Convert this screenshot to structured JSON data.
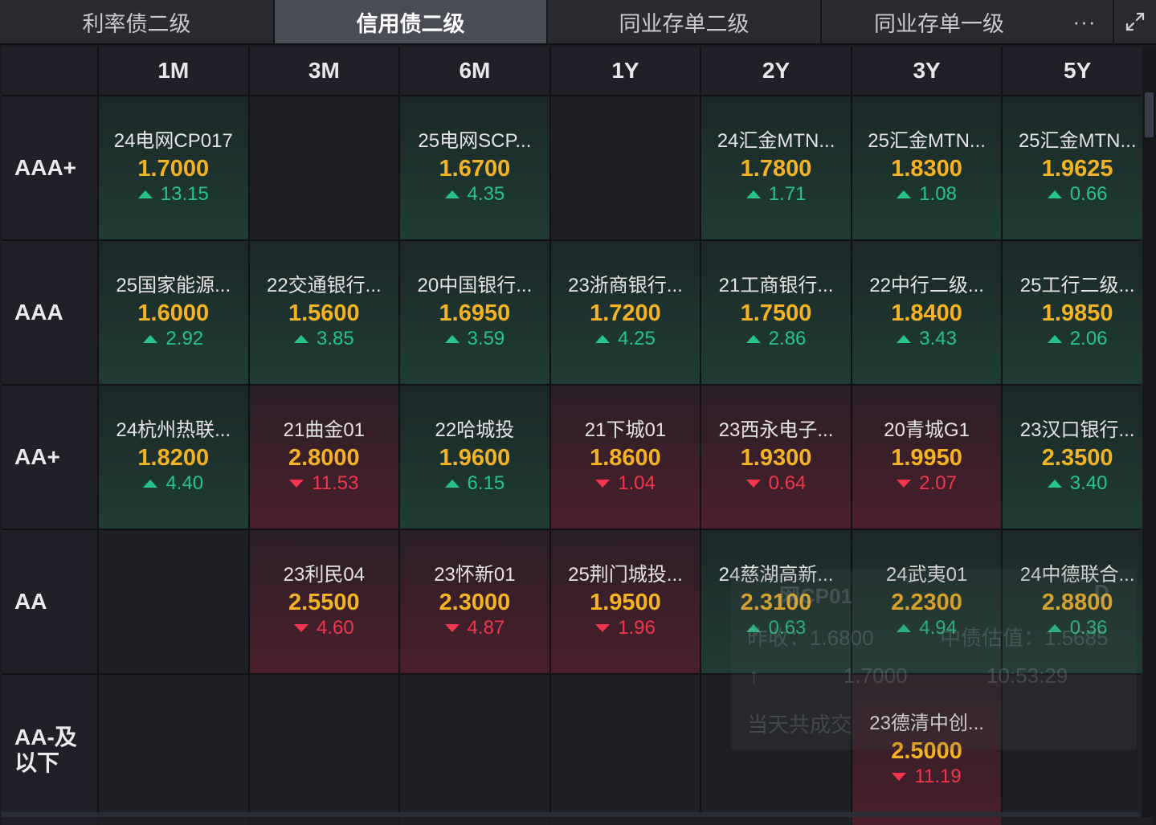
{
  "tabs": [
    {
      "label": "利率债二级",
      "active": false
    },
    {
      "label": "信用债二级",
      "active": true
    },
    {
      "label": "同业存单二级",
      "active": false
    },
    {
      "label": "同业存单一级",
      "active": false
    }
  ],
  "more_label": "···",
  "icons": {
    "more": "more-icon",
    "expand": "expand-icon"
  },
  "colors": {
    "rate": "#f5b324",
    "up": "#27c48a",
    "down": "#f2364b"
  },
  "columns": [
    "1M",
    "3M",
    "6M",
    "1Y",
    "2Y",
    "3Y",
    "5Y"
  ],
  "rows": [
    {
      "rating": "AAA+",
      "cells": [
        {
          "name": "24电网CP017",
          "rate": "1.7000",
          "change": "13.15",
          "dir": "up"
        },
        null,
        {
          "name": "25电网SCP...",
          "rate": "1.6700",
          "change": "4.35",
          "dir": "up"
        },
        null,
        {
          "name": "24汇金MTN...",
          "rate": "1.7800",
          "change": "1.71",
          "dir": "up"
        },
        {
          "name": "25汇金MTN...",
          "rate": "1.8300",
          "change": "1.08",
          "dir": "up"
        },
        {
          "name": "25汇金MTN...",
          "rate": "1.9625",
          "change": "0.66",
          "dir": "up"
        }
      ]
    },
    {
      "rating": "AAA",
      "cells": [
        {
          "name": "25国家能源...",
          "rate": "1.6000",
          "change": "2.92",
          "dir": "up"
        },
        {
          "name": "22交通银行...",
          "rate": "1.5600",
          "change": "3.85",
          "dir": "up"
        },
        {
          "name": "20中国银行...",
          "rate": "1.6950",
          "change": "3.59",
          "dir": "up"
        },
        {
          "name": "23浙商银行...",
          "rate": "1.7200",
          "change": "4.25",
          "dir": "up"
        },
        {
          "name": "21工商银行...",
          "rate": "1.7500",
          "change": "2.86",
          "dir": "up"
        },
        {
          "name": "22中行二级...",
          "rate": "1.8400",
          "change": "3.43",
          "dir": "up"
        },
        {
          "name": "25工行二级...",
          "rate": "1.9850",
          "change": "2.06",
          "dir": "up"
        }
      ]
    },
    {
      "rating": "AA+",
      "cells": [
        {
          "name": "24杭州热联...",
          "rate": "1.8200",
          "change": "4.40",
          "dir": "up"
        },
        {
          "name": "21曲金01",
          "rate": "2.8000",
          "change": "11.53",
          "dir": "down"
        },
        {
          "name": "22哈城投",
          "rate": "1.9600",
          "change": "6.15",
          "dir": "up"
        },
        {
          "name": "21下城01",
          "rate": "1.8600",
          "change": "1.04",
          "dir": "down"
        },
        {
          "name": "23西永电子...",
          "rate": "1.9300",
          "change": "0.64",
          "dir": "down"
        },
        {
          "name": "20青城G1",
          "rate": "1.9950",
          "change": "2.07",
          "dir": "down"
        },
        {
          "name": "23汉口银行...",
          "rate": "2.3500",
          "change": "3.40",
          "dir": "up"
        }
      ]
    },
    {
      "rating": "AA",
      "cells": [
        null,
        {
          "name": "23利民04",
          "rate": "2.5500",
          "change": "4.60",
          "dir": "down"
        },
        {
          "name": "23怀新01",
          "rate": "2.3000",
          "change": "4.87",
          "dir": "down"
        },
        {
          "name": "25荆门城投...",
          "rate": "1.9500",
          "change": "1.96",
          "dir": "down"
        },
        {
          "name": "24慈湖高新...",
          "rate": "2.3100",
          "change": "0.63",
          "dir": "up"
        },
        {
          "name": "24武夷01",
          "rate": "2.2300",
          "change": "4.94",
          "dir": "up"
        },
        {
          "name": "24中德联合...",
          "rate": "2.8800",
          "change": "0.36",
          "dir": "up"
        }
      ]
    },
    {
      "rating": "AA-及\n以下",
      "cells": [
        null,
        null,
        null,
        null,
        null,
        {
          "name": "23德清中创...",
          "rate": "2.5000",
          "change": "11.19",
          "dir": "down"
        },
        null
      ]
    }
  ],
  "tooltip": {
    "title": "网CP01",
    "title_suffix": "D",
    "prev_label": "昨收：1.6800",
    "valuation_label": "中债估值：1.5685",
    "arrow": "↑",
    "last_rate": "1.7000",
    "time": "10:53:29",
    "total_label": "当天共成交"
  }
}
